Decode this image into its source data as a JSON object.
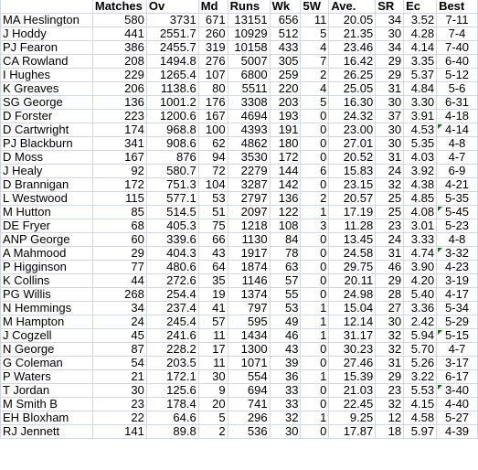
{
  "columns": [
    "",
    "Matches",
    "Ov",
    "Md",
    "Runs",
    "Wk",
    "5W",
    "Ave.",
    "SR",
    "Ec",
    "Best"
  ],
  "rows": [
    {
      "name": "MA Heslington",
      "matches": "580",
      "ov": "3731",
      "md": "671",
      "runs": "13151",
      "wk": "656",
      "fivew": "11",
      "ave": "20.05",
      "sr": "34",
      "ec": "3.52",
      "best": "7-11",
      "comment": false
    },
    {
      "name": "J Hoddy",
      "matches": "441",
      "ov": "2551.7",
      "md": "260",
      "runs": "10929",
      "wk": "512",
      "fivew": "5",
      "ave": "21.35",
      "sr": "30",
      "ec": "4.28",
      "best": "7-4",
      "comment": false
    },
    {
      "name": "PJ Fearon",
      "matches": "386",
      "ov": "2455.7",
      "md": "319",
      "runs": "10158",
      "wk": "433",
      "fivew": "4",
      "ave": "23.46",
      "sr": "34",
      "ec": "4.14",
      "best": "7-40",
      "comment": false
    },
    {
      "name": "CA Rowland",
      "matches": "208",
      "ov": "1494.8",
      "md": "276",
      "runs": "5007",
      "wk": "305",
      "fivew": "7",
      "ave": "16.42",
      "sr": "29",
      "ec": "3.35",
      "best": "6-40",
      "comment": false
    },
    {
      "name": "I Hughes",
      "matches": "229",
      "ov": "1265.4",
      "md": "107",
      "runs": "6800",
      "wk": "259",
      "fivew": "2",
      "ave": "26.25",
      "sr": "29",
      "ec": "5.37",
      "best": "5-12",
      "comment": false
    },
    {
      "name": "K Greaves",
      "matches": "206",
      "ov": "1138.6",
      "md": "80",
      "runs": "5511",
      "wk": "220",
      "fivew": "4",
      "ave": "25.05",
      "sr": "31",
      "ec": "4.84",
      "best": "5-6",
      "comment": false
    },
    {
      "name": "SG George",
      "matches": "136",
      "ov": "1001.2",
      "md": "176",
      "runs": "3308",
      "wk": "203",
      "fivew": "5",
      "ave": "16.30",
      "sr": "30",
      "ec": "3.30",
      "best": "6-31",
      "comment": false
    },
    {
      "name": "D Forster",
      "matches": "223",
      "ov": "1200.6",
      "md": "167",
      "runs": "4694",
      "wk": "193",
      "fivew": "0",
      "ave": "24.32",
      "sr": "37",
      "ec": "3.91",
      "best": "4-18",
      "comment": false
    },
    {
      "name": "D Cartwright",
      "matches": "174",
      "ov": "968.8",
      "md": "100",
      "runs": "4393",
      "wk": "191",
      "fivew": "0",
      "ave": "23.00",
      "sr": "30",
      "ec": "4.53",
      "best": "4-14",
      "comment": true
    },
    {
      "name": "PJ Blackburn",
      "matches": "341",
      "ov": "908.6",
      "md": "62",
      "runs": "4862",
      "wk": "180",
      "fivew": "0",
      "ave": "27.01",
      "sr": "30",
      "ec": "5.35",
      "best": "4-8",
      "comment": false
    },
    {
      "name": "D Moss",
      "matches": "167",
      "ov": "876",
      "md": "94",
      "runs": "3530",
      "wk": "172",
      "fivew": "0",
      "ave": "20.52",
      "sr": "31",
      "ec": "4.03",
      "best": "4-7",
      "comment": false
    },
    {
      "name": "J Healy",
      "matches": "92",
      "ov": "580.7",
      "md": "72",
      "runs": "2279",
      "wk": "144",
      "fivew": "6",
      "ave": "15.83",
      "sr": "24",
      "ec": "3.92",
      "best": "6-9",
      "comment": false
    },
    {
      "name": "D Brannigan",
      "matches": "172",
      "ov": "751.3",
      "md": "104",
      "runs": "3287",
      "wk": "142",
      "fivew": "0",
      "ave": "23.15",
      "sr": "32",
      "ec": "4.38",
      "best": "4-21",
      "comment": false
    },
    {
      "name": "L Westwood",
      "matches": "115",
      "ov": "577.1",
      "md": "53",
      "runs": "2797",
      "wk": "136",
      "fivew": "2",
      "ave": "20.57",
      "sr": "25",
      "ec": "4.85",
      "best": "5-35",
      "comment": false
    },
    {
      "name": "M Hutton",
      "matches": "85",
      "ov": "514.5",
      "md": "51",
      "runs": "2097",
      "wk": "122",
      "fivew": "1",
      "ave": "17.19",
      "sr": "25",
      "ec": "4.08",
      "best": "5-45",
      "comment": true
    },
    {
      "name": "DE Fryer",
      "matches": "68",
      "ov": "405.3",
      "md": "75",
      "runs": "1218",
      "wk": "108",
      "fivew": "3",
      "ave": "11.28",
      "sr": "23",
      "ec": "3.01",
      "best": "5-23",
      "comment": false
    },
    {
      "name": "ANP George",
      "matches": "60",
      "ov": "339.6",
      "md": "66",
      "runs": "1130",
      "wk": "84",
      "fivew": "0",
      "ave": "13.45",
      "sr": "24",
      "ec": "3.33",
      "best": "4-8",
      "comment": false
    },
    {
      "name": "A Mahmood",
      "matches": "29",
      "ov": "404.3",
      "md": "43",
      "runs": "1917",
      "wk": "78",
      "fivew": "0",
      "ave": "24.58",
      "sr": "31",
      "ec": "4.74",
      "best": "3-32",
      "comment": true
    },
    {
      "name": "P Higginson",
      "matches": "77",
      "ov": "480.6",
      "md": "64",
      "runs": "1874",
      "wk": "63",
      "fivew": "0",
      "ave": "29.75",
      "sr": "46",
      "ec": "3.90",
      "best": "4-23",
      "comment": false
    },
    {
      "name": "K Collins",
      "matches": "44",
      "ov": "272.6",
      "md": "35",
      "runs": "1146",
      "wk": "57",
      "fivew": "0",
      "ave": "20.11",
      "sr": "29",
      "ec": "4.20",
      "best": "3-19",
      "comment": false
    },
    {
      "name": "PG Willis",
      "matches": "268",
      "ov": "254.4",
      "md": "19",
      "runs": "1374",
      "wk": "55",
      "fivew": "0",
      "ave": "24.98",
      "sr": "28",
      "ec": "5.40",
      "best": "4-17",
      "comment": false
    },
    {
      "name": "N Hemmings",
      "matches": "34",
      "ov": "237.4",
      "md": "41",
      "runs": "797",
      "wk": "53",
      "fivew": "1",
      "ave": "15.04",
      "sr": "27",
      "ec": "3.36",
      "best": "5-34",
      "comment": false
    },
    {
      "name": "M Hampton",
      "matches": "24",
      "ov": "245.4",
      "md": "57",
      "runs": "595",
      "wk": "49",
      "fivew": "1",
      "ave": "12.14",
      "sr": "30",
      "ec": "2.42",
      "best": "5-29",
      "comment": false
    },
    {
      "name": "J Cogzell",
      "matches": "45",
      "ov": "241.6",
      "md": "11",
      "runs": "1434",
      "wk": "46",
      "fivew": "1",
      "ave": "31.17",
      "sr": "32",
      "ec": "5.94",
      "best": "5-15",
      "comment": true
    },
    {
      "name": "N George",
      "matches": "87",
      "ov": "228.2",
      "md": "17",
      "runs": "1300",
      "wk": "43",
      "fivew": "0",
      "ave": "30.23",
      "sr": "32",
      "ec": "5.70",
      "best": "4-7",
      "comment": false
    },
    {
      "name": "G Coleman",
      "matches": "54",
      "ov": "203.5",
      "md": "11",
      "runs": "1071",
      "wk": "39",
      "fivew": "0",
      "ave": "27.46",
      "sr": "31",
      "ec": "5.26",
      "best": "3-17",
      "comment": false
    },
    {
      "name": "P Waters",
      "matches": "21",
      "ov": "172.1",
      "md": "30",
      "runs": "554",
      "wk": "36",
      "fivew": "1",
      "ave": "15.39",
      "sr": "29",
      "ec": "3.22",
      "best": "6-17",
      "comment": false
    },
    {
      "name": "T Jordan",
      "matches": "30",
      "ov": "125.6",
      "md": "9",
      "runs": "694",
      "wk": "33",
      "fivew": "0",
      "ave": "21.03",
      "sr": "23",
      "ec": "5.53",
      "best": "3-40",
      "comment": true
    },
    {
      "name": "M Smith B",
      "matches": "23",
      "ov": "178.4",
      "md": "20",
      "runs": "741",
      "wk": "33",
      "fivew": "0",
      "ave": "22.45",
      "sr": "32",
      "ec": "4.15",
      "best": "4-40",
      "comment": false
    },
    {
      "name": "EH Bloxham",
      "matches": "22",
      "ov": "64.6",
      "md": "5",
      "runs": "296",
      "wk": "32",
      "fivew": "1",
      "ave": "9.25",
      "sr": "12",
      "ec": "4.58",
      "best": "5-27",
      "comment": false
    },
    {
      "name": "RJ Jennett",
      "matches": "141",
      "ov": "89.8",
      "md": "2",
      "runs": "536",
      "wk": "30",
      "fivew": "0",
      "ave": "17.87",
      "sr": "18",
      "ec": "5.97",
      "best": "4-39",
      "comment": false
    }
  ],
  "colors": {
    "gridline": "#d0d7e5",
    "comment_marker": "#008000"
  }
}
